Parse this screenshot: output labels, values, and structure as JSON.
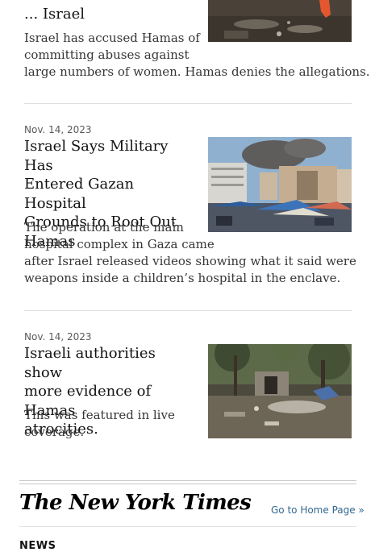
{
  "articles": [
    {
      "headline_lines": [
        "... Israel"
      ],
      "summary_lines": [
        "Israel has accused Hamas of",
        "committing abuses against",
        "large numbers of women. Hamas denies the allegations."
      ]
    },
    {
      "date": "Nov. 14, 2023",
      "headline_lines": [
        "Israel Says Military Has",
        "Entered Gazan Hospital",
        "Grounds to Root Out",
        "Hamas"
      ],
      "summary_lines": [
        "The operation at the main",
        "hospital complex in Gaza came",
        "after Israel released videos showing what it said were",
        "weapons inside a children’s hospital in the enclave."
      ]
    },
    {
      "date": "Nov. 14, 2023",
      "headline_lines": [
        "Israeli authorities show",
        "more evidence of Hamas",
        "atrocities."
      ],
      "summary_lines": [
        "This was featured in live",
        "coverage."
      ]
    }
  ],
  "footer": {
    "masthead": "The New York Times",
    "home_link": "Go to Home Page »",
    "section_label": "NEWS"
  }
}
